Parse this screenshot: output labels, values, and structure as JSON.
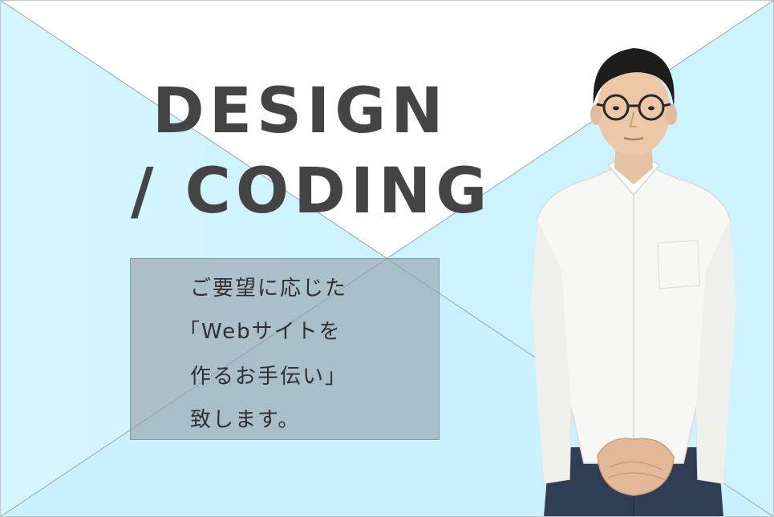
{
  "headline": {
    "line1": "DESIGN",
    "line2": "/ CODING"
  },
  "message": {
    "lines": [
      "ご要望に応じた",
      "「Webサイトを",
      "作るお手伝い」",
      "致します。"
    ]
  },
  "colors": {
    "background_light_blue": "#ccf3ff",
    "background_white": "#ffffff",
    "headline_text": "#444444",
    "box_fill": "#94a0aa",
    "shirt": "#f7f7f5",
    "jeans": "#2f3e55"
  },
  "icons": {
    "portrait": "person-photo"
  }
}
